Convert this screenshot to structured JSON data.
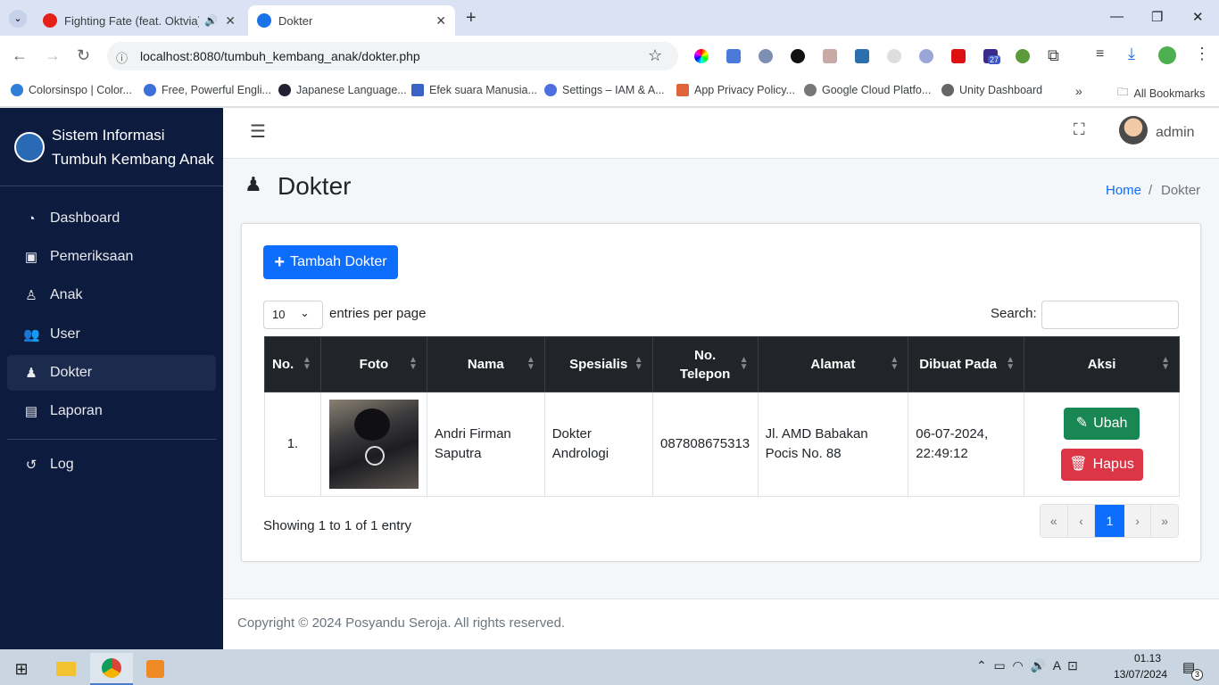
{
  "browser": {
    "tabs": [
      {
        "title": "Fighting Fate (feat. Oktvia)",
        "active": false
      },
      {
        "title": "Dokter",
        "active": true
      }
    ],
    "url": "localhost:8080/tumbuh_kembang_anak/dokter.php",
    "bookmarks": [
      "Colorsinspo | Color...",
      "Free, Powerful Engli...",
      "Japanese Language...",
      "Efek suara Manusia...",
      "Settings – IAM & A...",
      "App Privacy Policy...",
      "Google Cloud Platfo...",
      "Unity Dashboard"
    ],
    "all_bookmarks": "All Bookmarks",
    "ext_badge": "27"
  },
  "app": {
    "brand_line1": "Sistem Informasi",
    "brand_line2": "Tumbuh Kembang Anak",
    "menu": [
      {
        "label": "Dashboard",
        "icon": "gauge-icon"
      },
      {
        "label": "Pemeriksaan",
        "icon": "clipboard-icon"
      },
      {
        "label": "Anak",
        "icon": "child-icon"
      },
      {
        "label": "User",
        "icon": "users-icon"
      },
      {
        "label": "Dokter",
        "icon": "doctor-icon"
      },
      {
        "label": "Laporan",
        "icon": "file-icon"
      },
      {
        "label": "Log",
        "icon": "history-icon"
      }
    ],
    "user": "admin"
  },
  "page": {
    "title": "Dokter",
    "breadcrumb_home": "Home",
    "breadcrumb_sep": "/",
    "breadcrumb_current": "Dokter",
    "add_button": "Tambah Dokter",
    "entries_value": "10",
    "entries_label": "entries per page",
    "search_label": "Search:",
    "columns": [
      "No.",
      "Foto",
      "Nama",
      "Spesialis",
      "No. Telepon",
      "Alamat",
      "Dibuat Pada",
      "Aksi"
    ],
    "rows": [
      {
        "no": "1.",
        "nama": "Andri Firman Saputra",
        "spesialis": "Dokter Andrologi",
        "telepon": "087808675313",
        "alamat": "Jl. AMD Babakan Pocis No. 88",
        "dibuat": "06-07-2024, 22:49:12"
      }
    ],
    "edit_label": "Ubah",
    "delete_label": "Hapus",
    "showing": "Showing 1 to 1 of 1 entry",
    "pagination": [
      "«",
      "‹",
      "1",
      "›",
      "»"
    ],
    "footer": "Copyright © 2024 Posyandu Seroja. All rights reserved."
  },
  "taskbar": {
    "time": "01.13",
    "date": "13/07/2024",
    "notif_count": "3"
  },
  "colors": {
    "primary": "#0d6efd",
    "success": "#198754",
    "danger": "#dc3545",
    "sidebar": "#0d1b3e"
  }
}
